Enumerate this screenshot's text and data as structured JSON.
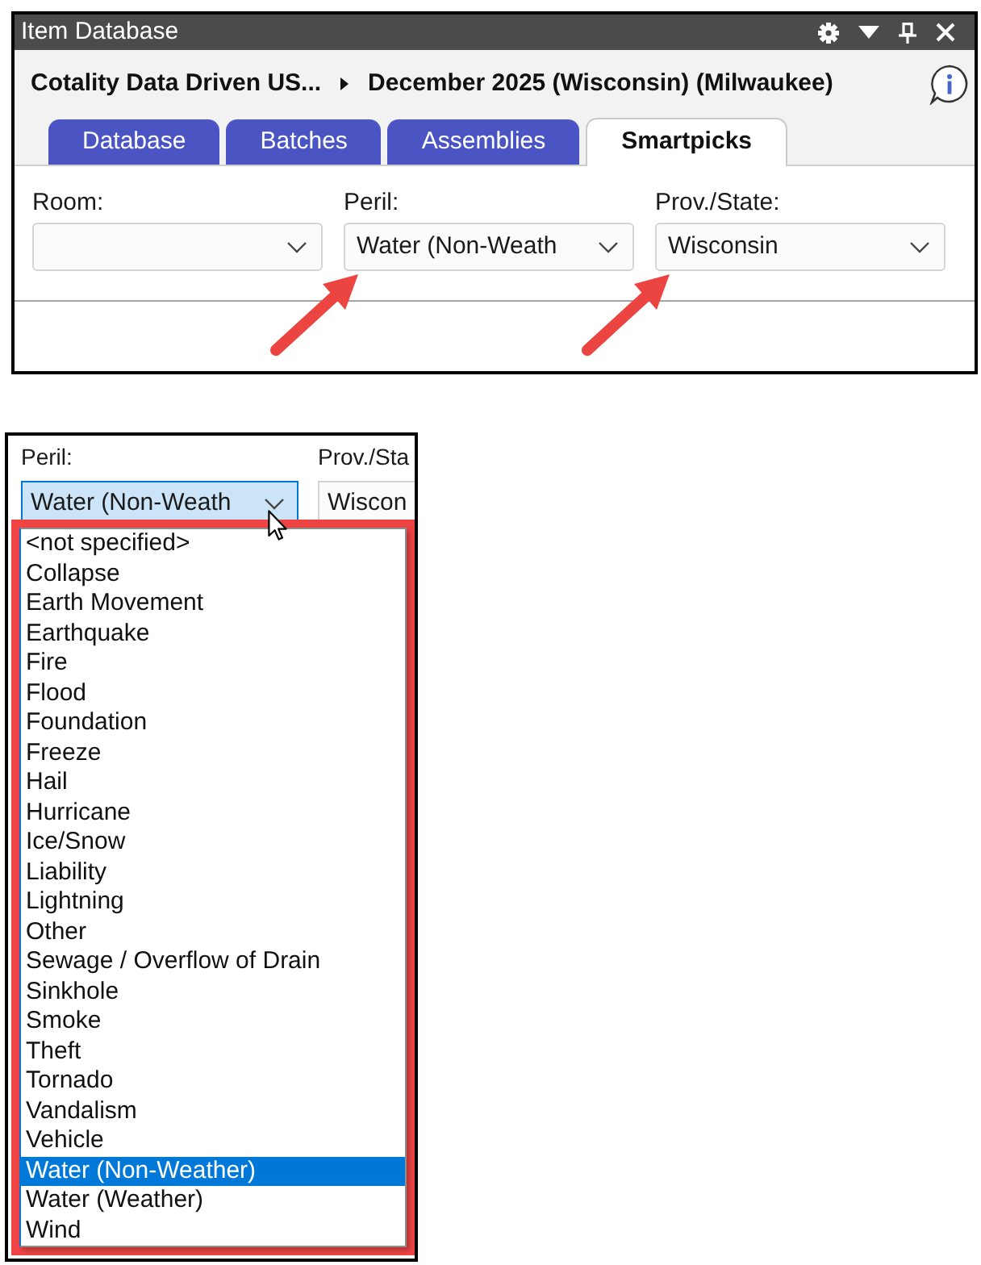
{
  "item_database": {
    "window": {
      "title": "Item Database"
    },
    "breadcrumb": [
      "Cotality Data Driven US...",
      "December 2025 (Wisconsin) (Milwaukee)"
    ],
    "tabs": [
      {
        "label": "Database",
        "selected": false
      },
      {
        "label": "Batches",
        "selected": false
      },
      {
        "label": "Assemblies",
        "selected": false
      },
      {
        "label": "Smartpicks",
        "selected": true
      }
    ],
    "filters": [
      {
        "label": "Room:",
        "arrow": false
      },
      {
        "label": "Peril:",
        "value": "Water (Non-Weath",
        "arrow": true
      },
      {
        "label": "Prov./State:",
        "value": "Wisconsin",
        "arrow": true
      }
    ]
  },
  "peril_dropdown": {
    "fields": [
      {
        "label": "Peril:",
        "value": "Water (Non-Weath",
        "focused": true
      },
      {
        "label": "Prov./Sta",
        "value": "Wiscon",
        "focused": false
      }
    ],
    "highlighted": true,
    "options": [
      {
        "label": "<not specified>",
        "selected": false
      },
      {
        "label": "Collapse",
        "selected": false
      },
      {
        "label": "Earth Movement",
        "selected": false
      },
      {
        "label": "Earthquake",
        "selected": false
      },
      {
        "label": "Fire",
        "selected": false
      },
      {
        "label": "Flood",
        "selected": false
      },
      {
        "label": "Foundation",
        "selected": false
      },
      {
        "label": "Freeze",
        "selected": false
      },
      {
        "label": "Hail",
        "selected": false
      },
      {
        "label": "Hurricane",
        "selected": false
      },
      {
        "label": "Ice/Snow",
        "selected": false
      },
      {
        "label": "Liability",
        "selected": false
      },
      {
        "label": "Lightning",
        "selected": false
      },
      {
        "label": "Other",
        "selected": false
      },
      {
        "label": "Sewage / Overflow of Drain",
        "selected": false
      },
      {
        "label": "Sinkhole",
        "selected": false
      },
      {
        "label": "Smoke",
        "selected": false
      },
      {
        "label": "Theft",
        "selected": false
      },
      {
        "label": "Tornado",
        "selected": false
      },
      {
        "label": "Vandalism",
        "selected": false
      },
      {
        "label": "Vehicle",
        "selected": false
      },
      {
        "label": "Water (Non-Weather)",
        "selected": true
      },
      {
        "label": "Water (Weather)",
        "selected": false
      },
      {
        "label": "Wind",
        "selected": false
      }
    ]
  }
}
